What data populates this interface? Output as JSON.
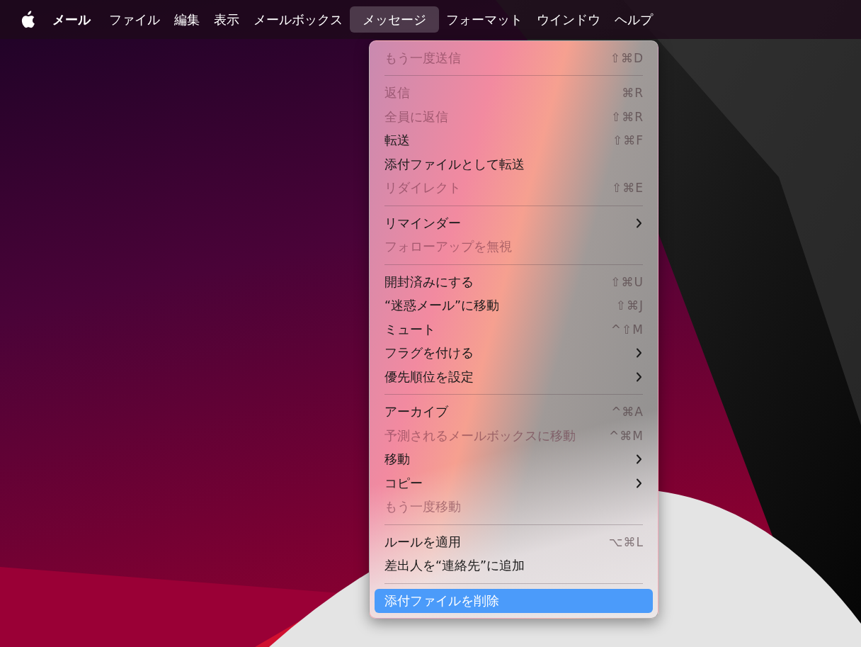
{
  "menubar": {
    "items": [
      {
        "label": "メール",
        "kind": "app",
        "selected": false
      },
      {
        "label": "ファイル",
        "kind": "menu",
        "selected": false
      },
      {
        "label": "編集",
        "kind": "menu",
        "selected": false
      },
      {
        "label": "表示",
        "kind": "menu",
        "selected": false
      },
      {
        "label": "メールボックス",
        "kind": "menu",
        "selected": false
      },
      {
        "label": "メッセージ",
        "kind": "menu",
        "selected": true
      },
      {
        "label": "フォーマット",
        "kind": "menu",
        "selected": false
      },
      {
        "label": "ウインドウ",
        "kind": "menu",
        "selected": false
      },
      {
        "label": "ヘルプ",
        "kind": "menu",
        "selected": false
      }
    ]
  },
  "menu": {
    "items": [
      {
        "kind": "item",
        "label": "もう一度送信",
        "shortcut": "⇧⌘D",
        "disabled": true,
        "submenu": false,
        "selected": false
      },
      {
        "kind": "separator"
      },
      {
        "kind": "item",
        "label": "返信",
        "shortcut": "⌘R",
        "disabled": true,
        "submenu": false,
        "selected": false
      },
      {
        "kind": "item",
        "label": "全員に返信",
        "shortcut": "⇧⌘R",
        "disabled": true,
        "submenu": false,
        "selected": false
      },
      {
        "kind": "item",
        "label": "転送",
        "shortcut": "⇧⌘F",
        "disabled": false,
        "submenu": false,
        "selected": false
      },
      {
        "kind": "item",
        "label": "添付ファイルとして転送",
        "disabled": false,
        "submenu": false,
        "selected": false
      },
      {
        "kind": "item",
        "label": "リダイレクト",
        "shortcut": "⇧⌘E",
        "disabled": true,
        "submenu": false,
        "selected": false
      },
      {
        "kind": "separator"
      },
      {
        "kind": "item",
        "label": "リマインダー",
        "disabled": false,
        "submenu": true,
        "selected": false
      },
      {
        "kind": "item",
        "label": "フォローアップを無視",
        "disabled": true,
        "submenu": false,
        "selected": false
      },
      {
        "kind": "separator"
      },
      {
        "kind": "item",
        "label": "開封済みにする",
        "shortcut": "⇧⌘U",
        "disabled": false,
        "submenu": false,
        "selected": false
      },
      {
        "kind": "item",
        "label": "“迷惑メール”に移動",
        "shortcut": "⇧⌘J",
        "disabled": false,
        "submenu": false,
        "selected": false
      },
      {
        "kind": "item",
        "label": "ミュート",
        "shortcut": "^⇧M",
        "disabled": false,
        "submenu": false,
        "selected": false
      },
      {
        "kind": "item",
        "label": "フラグを付ける",
        "disabled": false,
        "submenu": true,
        "selected": false
      },
      {
        "kind": "item",
        "label": "優先順位を設定",
        "disabled": false,
        "submenu": true,
        "selected": false
      },
      {
        "kind": "separator"
      },
      {
        "kind": "item",
        "label": "アーカイブ",
        "shortcut": "^⌘A",
        "disabled": false,
        "submenu": false,
        "selected": false
      },
      {
        "kind": "item",
        "label": "予測されるメールボックスに移動",
        "shortcut": "^⌘M",
        "disabled": true,
        "submenu": false,
        "selected": false
      },
      {
        "kind": "item",
        "label": "移動",
        "disabled": false,
        "submenu": true,
        "selected": false
      },
      {
        "kind": "item",
        "label": "コピー",
        "disabled": false,
        "submenu": true,
        "selected": false
      },
      {
        "kind": "item",
        "label": "もう一度移動",
        "disabled": true,
        "submenu": false,
        "selected": false
      },
      {
        "kind": "separator"
      },
      {
        "kind": "item",
        "label": "ルールを適用",
        "shortcut": "⌥⌘L",
        "disabled": false,
        "submenu": false,
        "selected": false
      },
      {
        "kind": "item",
        "label": "差出人を“連絡先”に追加",
        "disabled": false,
        "submenu": false,
        "selected": false
      },
      {
        "kind": "separator"
      },
      {
        "kind": "item",
        "label": "添付ファイルを削除",
        "disabled": false,
        "submenu": false,
        "selected": true
      }
    ]
  }
}
